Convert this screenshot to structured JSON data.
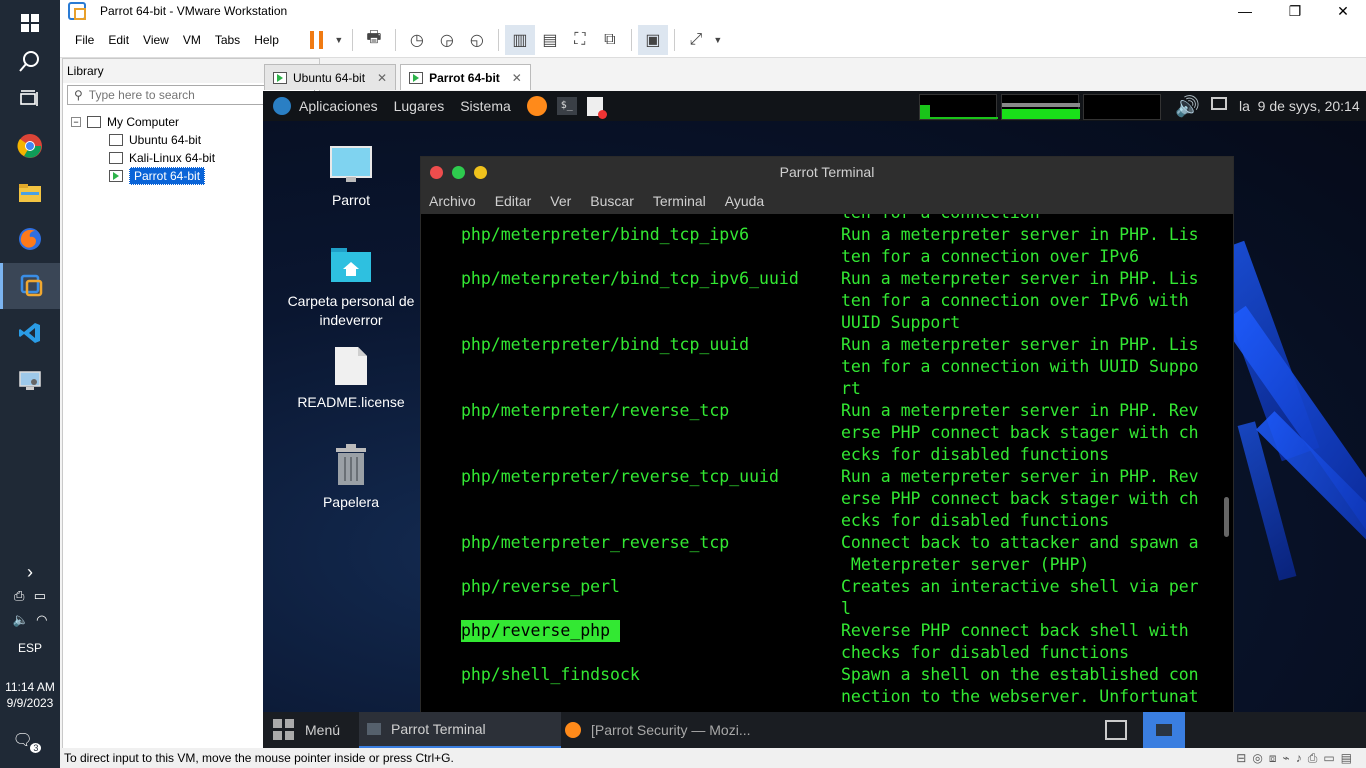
{
  "windows_taskbar": {
    "apps": [
      "windows-start",
      "search",
      "task-view",
      "chrome",
      "file-explorer",
      "firefox",
      "vmware",
      "vscode",
      "control-panel"
    ],
    "language": "ESP",
    "time": "11:14 AM",
    "date": "9/9/2023",
    "notifications_count": "3"
  },
  "vmware": {
    "title": "Parrot 64-bit - VMware Workstation",
    "menu": [
      "File",
      "Edit",
      "View",
      "VM",
      "Tabs",
      "Help"
    ],
    "library": {
      "title": "Library",
      "search_placeholder": "Type here to search",
      "root": "My Computer",
      "vms": [
        "Ubuntu 64-bit",
        "Kali-Linux 64-bit",
        "Parrot 64-bit"
      ],
      "selected": "Parrot 64-bit"
    },
    "tabs": [
      {
        "label": "Ubuntu 64-bit",
        "active": false
      },
      {
        "label": "Parrot 64-bit",
        "active": true
      }
    ],
    "status": "To direct input to this VM, move the mouse pointer inside or press Ctrl+G."
  },
  "parrot": {
    "topbar": {
      "menus": [
        "Aplicaciones",
        "Lugares",
        "Sistema"
      ],
      "clock": "la  9 de syys, 20:14"
    },
    "desktop_icons": [
      {
        "label": "Parrot",
        "icon": "monitor-icon"
      },
      {
        "label": "Carpeta personal de indeverror",
        "icon": "home-folder-icon"
      },
      {
        "label": "README.license",
        "icon": "file-icon"
      },
      {
        "label": "Papelera",
        "icon": "trash-icon"
      }
    ],
    "terminal": {
      "title": "Parrot Terminal",
      "menu": [
        "Archivo",
        "Editar",
        "Ver",
        "Buscar",
        "Terminal",
        "Ayuda"
      ],
      "lines": [
        {
          "cmd": "",
          "desc": "ten for a connection"
        },
        {
          "cmd": "php/meterpreter/bind_tcp_ipv6",
          "desc": "Run a meterpreter server in PHP. Lis"
        },
        {
          "cmd": "",
          "desc": "ten for a connection over IPv6"
        },
        {
          "cmd": "php/meterpreter/bind_tcp_ipv6_uuid",
          "desc": "Run a meterpreter server in PHP. Lis"
        },
        {
          "cmd": "",
          "desc": "ten for a connection over IPv6 with"
        },
        {
          "cmd": "",
          "desc": "UUID Support"
        },
        {
          "cmd": "php/meterpreter/bind_tcp_uuid",
          "desc": "Run a meterpreter server in PHP. Lis"
        },
        {
          "cmd": "",
          "desc": "ten for a connection with UUID Suppo"
        },
        {
          "cmd": "",
          "desc": "rt"
        },
        {
          "cmd": "php/meterpreter/reverse_tcp",
          "desc": "Run a meterpreter server in PHP. Rev"
        },
        {
          "cmd": "",
          "desc": "erse PHP connect back stager with ch"
        },
        {
          "cmd": "",
          "desc": "ecks for disabled functions"
        },
        {
          "cmd": "php/meterpreter/reverse_tcp_uuid",
          "desc": "Run a meterpreter server in PHP. Rev"
        },
        {
          "cmd": "",
          "desc": "erse PHP connect back stager with ch"
        },
        {
          "cmd": "",
          "desc": "ecks for disabled functions"
        },
        {
          "cmd": "php/meterpreter_reverse_tcp",
          "desc": "Connect back to attacker and spawn a"
        },
        {
          "cmd": "",
          "desc": " Meterpreter server (PHP)"
        },
        {
          "cmd": "php/reverse_perl",
          "desc": "Creates an interactive shell via per"
        },
        {
          "cmd": "",
          "desc": "l"
        },
        {
          "cmd": "php/reverse_php ",
          "desc": "Reverse PHP connect back shell with",
          "highlight": true
        },
        {
          "cmd": "",
          "desc": "checks for disabled functions"
        },
        {
          "cmd": "php/shell_findsock",
          "desc": "Spawn a shell on the established con"
        },
        {
          "cmd": "",
          "desc": "nection to the webserver. Unfortunat"
        }
      ]
    },
    "bottom_panel": {
      "menu": "Menú",
      "tasks": [
        "Parrot Terminal",
        "[Parrot Security — Mozi..."
      ]
    }
  }
}
